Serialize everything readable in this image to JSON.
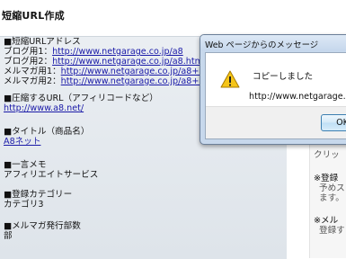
{
  "page": {
    "title": "短縮URL作成"
  },
  "form": {
    "short_url": {
      "heading": "■短縮URLアドレス",
      "rows": [
        {
          "label": "ブログ用1：",
          "url": "http://www.netgarage.co.jp/a8"
        },
        {
          "label": "ブログ用2：",
          "url": "http://www.netgarage.co.jp/a8.html"
        },
        {
          "label": "メルマガ用1：",
          "url": "http://www.netgarage.co.jp/a8+m"
        },
        {
          "label": "メルマガ用2：",
          "url": "http://www.netgarage.co.jp/a8+m.html"
        }
      ]
    },
    "target_url": {
      "heading": "■圧縮するURL（アフィリコードなど）",
      "value": "http://www.a8.net/"
    },
    "title_field": {
      "heading": "■タイトル（商品名）",
      "value": "A8ネット"
    },
    "memo": {
      "heading": "■一言メモ",
      "value": "アフィリエイトサービス"
    },
    "category": {
      "heading": "■登録カテゴリー",
      "value": "カテゴリ3"
    },
    "mailmag_count": {
      "heading": "■メルマガ発行部数",
      "value": "部"
    }
  },
  "right_panel": {
    "lines": [
      "クリッ",
      "※登録",
      "予めス",
      "ます。",
      "※メル",
      "登録す"
    ]
  },
  "dialog": {
    "title": "Web ページからのメッセージ",
    "message": "コピーしました",
    "url": "http://www.netgarage.co.jp/a8",
    "ok_label": "OK",
    "icon": "warning-icon"
  }
}
